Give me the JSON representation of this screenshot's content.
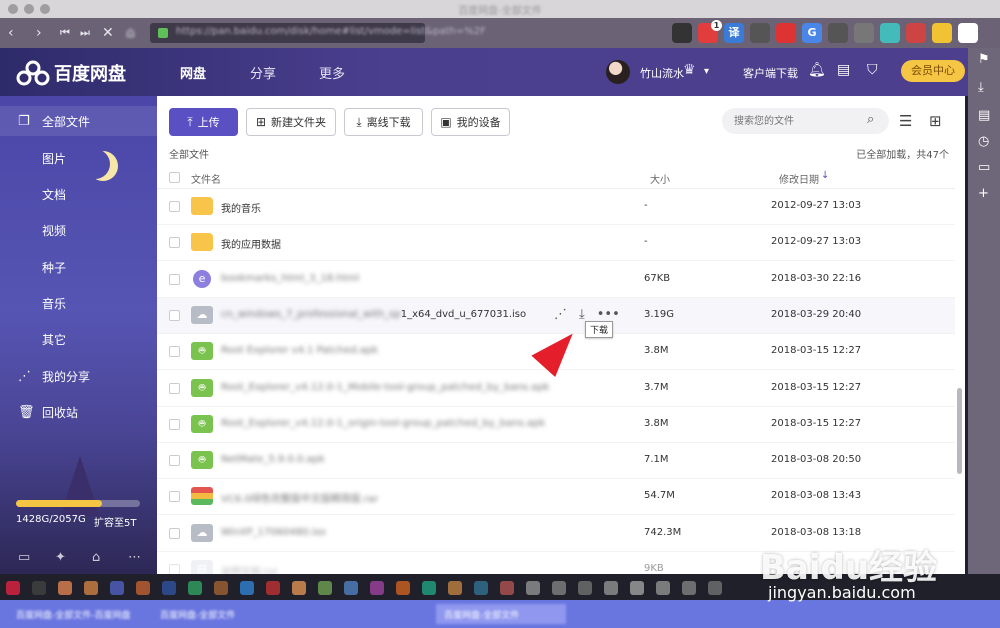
{
  "window": {
    "title": "百度网盘-全部文件"
  },
  "browser": {
    "address": "https://pan.baidu.com/disk/home#list/vmode=list&path=%2F",
    "extensions": [
      {
        "icon": "screen-icon",
        "color": "#333"
      },
      {
        "icon": "shield-red-icon",
        "color": "#e23d3d",
        "badge": "1"
      },
      {
        "icon": "translate-icon",
        "color": "#3b7bd8",
        "label": "译"
      },
      {
        "icon": "mask-icon",
        "color": "#555"
      },
      {
        "icon": "adblock-icon",
        "color": "#d33"
      },
      {
        "icon": "google-translate-icon",
        "color": "#4a86e8",
        "label": "G"
      },
      {
        "icon": "grid-icon",
        "color": "#555"
      },
      {
        "icon": "download-gray-icon",
        "color": "#777"
      },
      {
        "icon": "wand-icon",
        "color": "#4bb"
      },
      {
        "icon": "download-red-icon",
        "color": "#c44"
      },
      {
        "icon": "bulb-icon",
        "color": "#f1c232"
      },
      {
        "icon": "cube-icon",
        "color": "#fff"
      }
    ]
  },
  "header": {
    "logo": "百度网盘",
    "nav": [
      "网盘",
      "分享",
      "更多"
    ],
    "username": "竹山流水",
    "client_download": "客户端下载",
    "vip_center": "会员中心"
  },
  "sidebar": {
    "all_files": "全部文件",
    "categories": [
      "图片",
      "文档",
      "视频",
      "种子",
      "音乐",
      "其它"
    ],
    "my_share": "我的分享",
    "recycle": "回收站",
    "quota_used": "1428G/2057G",
    "quota_fraction": 0.694,
    "expand": "扩容至5T"
  },
  "toolbar": {
    "upload": "上传",
    "new_folder": "新建文件夹",
    "offline_download": "离线下载",
    "my_devices": "我的设备",
    "search_placeholder": "搜索您的文件"
  },
  "list": {
    "breadcrumb": "全部文件",
    "loaded_text": "已全部加载，共47个",
    "col_name": "文件名",
    "col_size": "大小",
    "col_date": "修改日期",
    "rows": [
      {
        "type": "folder",
        "name": "我的音乐",
        "size": "-",
        "date": "2012-09-27 13:03"
      },
      {
        "type": "folder",
        "name": "我的应用数据",
        "size": "-",
        "date": "2012-09-27 13:03"
      },
      {
        "type": "doc-e",
        "name": "bookmarks_html_3_18.html",
        "size": "67KB",
        "date": "2018-03-30 22:16",
        "blurred": true
      },
      {
        "type": "iso",
        "name": "cn_windows_7_professional_with_sp1_x64_dvd_u_677031.iso",
        "size": "3.19G",
        "date": "2018-03-29 20:40",
        "partial_blur": "cn_windows_7_professional_with_sp",
        "clear_tail": "1_x64_dvd_u_677031.iso"
      },
      {
        "type": "apk",
        "name": "Root Explorer v4.1 Patched.apk",
        "size": "3.8M",
        "date": "2018-03-15 12:27",
        "blurred": true
      },
      {
        "type": "apk",
        "name": "Root_Explorer_v4.12.0-1_Mobile-tool-group_patched_by_bans.apk",
        "size": "3.7M",
        "date": "2018-03-15 12:27",
        "blurred": true
      },
      {
        "type": "apk",
        "name": "Root_Explorer_v4.12.0-1_origin-tool-group_patched_by_bans.apk",
        "size": "3.8M",
        "date": "2018-03-15 12:27",
        "blurred": true
      },
      {
        "type": "apk",
        "name": "NetMate_5.9.0.0.apk",
        "size": "7.1M",
        "date": "2018-03-08 20:50",
        "blurred": true
      },
      {
        "type": "zip",
        "name": "VC6.0绿色完整版中文版精简版.rar",
        "size": "54.7M",
        "date": "2018-03-08 13:43",
        "blurred": true
      },
      {
        "type": "iso",
        "name": "WinXP_17060480.iso",
        "size": "742.3M",
        "date": "2018-03-08 13:18",
        "blurred": true
      },
      {
        "type": "doc",
        "name": "说明文档.txt",
        "size": "9KB",
        "date": "",
        "blurred": true
      }
    ],
    "tooltip": "下载"
  },
  "watermark": {
    "brand": "Baidu经验",
    "url": "jingyan.baidu.com"
  },
  "taskbar": {
    "tabs": [
      "百度网盘-全部文件-百度网盘",
      "百度网盘-全部文件",
      "百度网盘-全部文件"
    ]
  }
}
